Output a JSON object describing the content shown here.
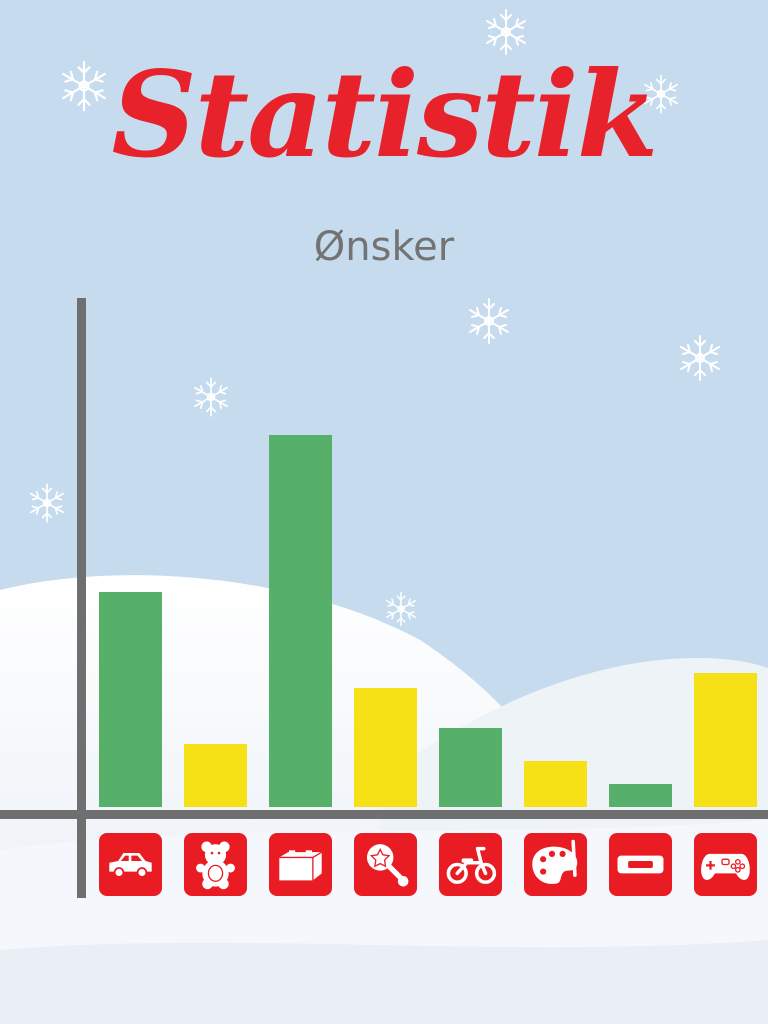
{
  "page": {
    "title": "Statistik",
    "subtitle": "Ønsker"
  },
  "colors": {
    "sky": "#c6dcee",
    "snow": "#f2f6fa",
    "title": "#e8222a",
    "subtitle": "#737373",
    "axis": "#6f6f6f",
    "green": "#56b06a",
    "yellow": "#f6e117",
    "icon_bg": "#e91c24",
    "snowflake": "#ffffff"
  },
  "chart_data": {
    "type": "bar",
    "categories": [
      "car-icon",
      "teddy-bear-icon",
      "building-blocks-icon",
      "rattle-icon",
      "balance-bike-icon",
      "paint-palette-icon",
      "pencil-case-icon",
      "game-controller-icon"
    ],
    "values": [
      215,
      63,
      372,
      119,
      79,
      46,
      23,
      134
    ],
    "bar_colors": [
      "green",
      "yellow",
      "green",
      "yellow",
      "green",
      "yellow",
      "green",
      "yellow"
    ],
    "ylim": [
      0,
      510
    ],
    "grid": false,
    "legend": "none",
    "title": "",
    "xlabel": "",
    "ylabel": ""
  }
}
